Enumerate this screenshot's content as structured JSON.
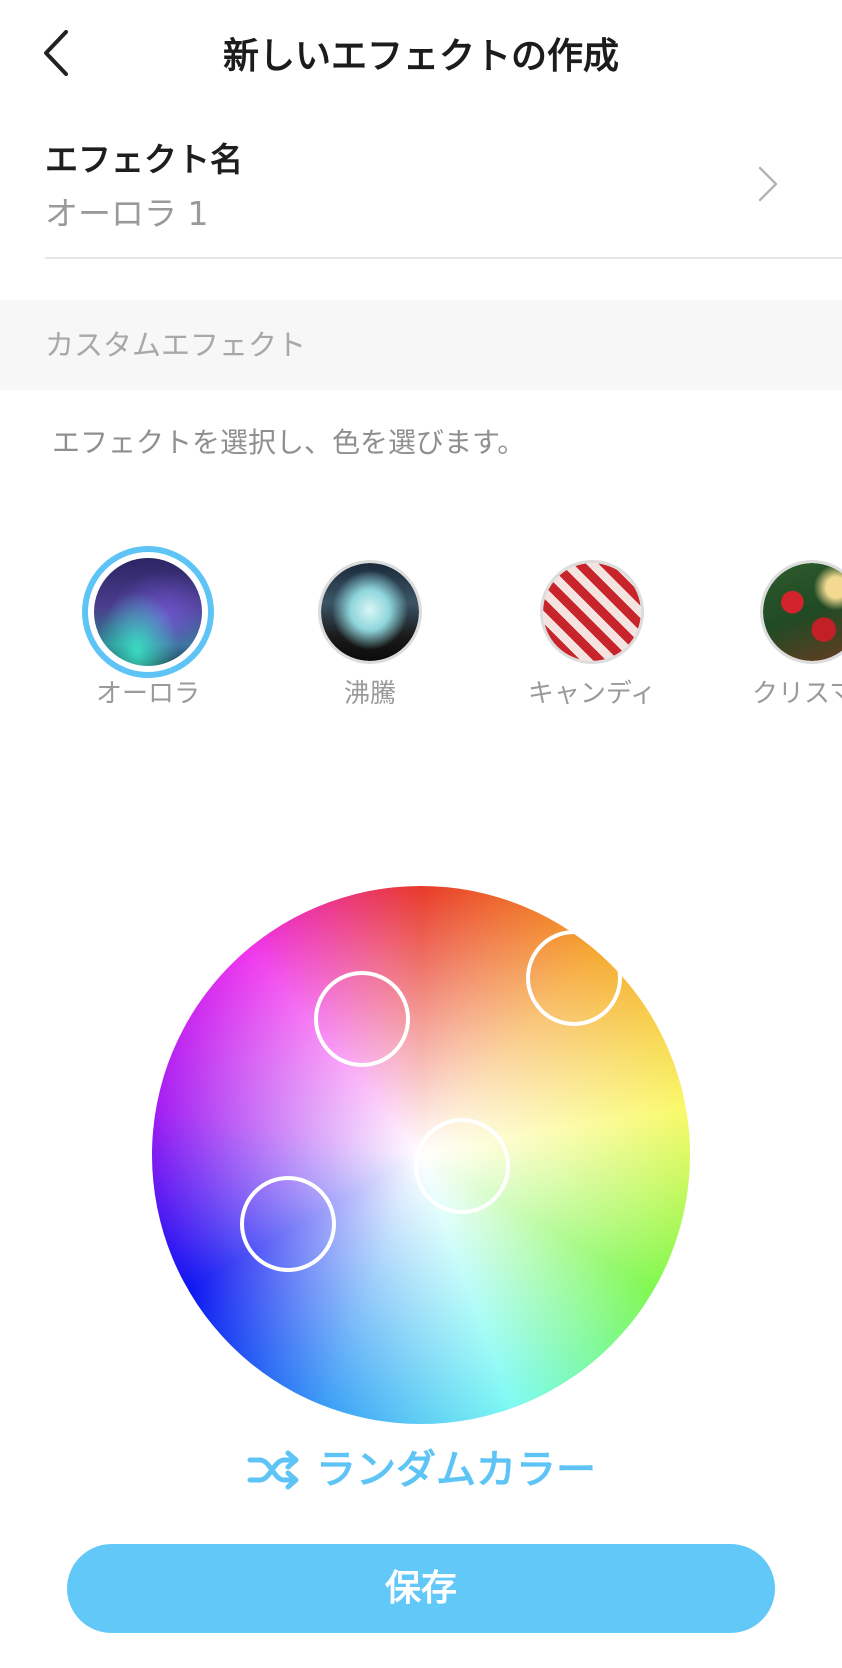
{
  "header": {
    "title": "新しいエフェクトの作成",
    "back_icon": "chevron-left-icon"
  },
  "effect_name": {
    "label": "エフェクト名",
    "value": "オーロラ 1",
    "chevron_icon": "chevron-right-icon"
  },
  "custom_section": {
    "title": "カスタムエフェクト"
  },
  "instruction": "エフェクトを選択し、色を選びます。",
  "effects": [
    {
      "label": "オーロラ",
      "selected": true
    },
    {
      "label": "沸騰",
      "selected": false
    },
    {
      "label": "キャンディ",
      "selected": false
    },
    {
      "label": "クリスマ",
      "selected": false
    }
  ],
  "color_wheel": {
    "handle_count": 4
  },
  "random_color": {
    "label": "ランダムカラー",
    "icon": "shuffle-icon"
  },
  "save_button": {
    "label": "保存"
  },
  "colors": {
    "accent": "#5ec4f5",
    "save_bg": "#62c8f8",
    "muted_text": "#9a9a9a",
    "section_bg": "#f7f7f7"
  }
}
